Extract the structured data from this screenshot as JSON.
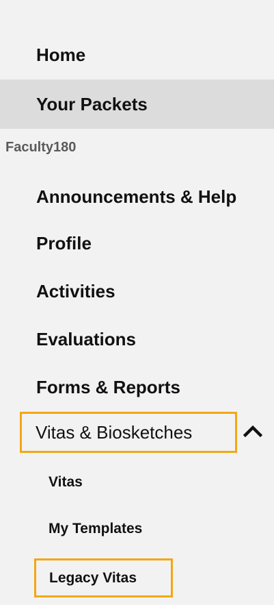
{
  "nav": {
    "top_items": [
      {
        "label": "Home"
      },
      {
        "label": "Your Packets"
      }
    ],
    "section_label": "Faculty180",
    "main_items": [
      {
        "label": "Announcements & Help"
      },
      {
        "label": "Profile"
      },
      {
        "label": "Activities"
      },
      {
        "label": "Evaluations"
      },
      {
        "label": "Forms & Reports"
      },
      {
        "label": "Vitas & Biosketches"
      }
    ],
    "sub_items": [
      {
        "label": "Vitas"
      },
      {
        "label": "My Templates"
      },
      {
        "label": "Legacy Vitas"
      }
    ],
    "highlight_color": "#f3a712",
    "active_item_bg": "#dcdcdc",
    "expanded_icon": "chevron-up-icon"
  }
}
